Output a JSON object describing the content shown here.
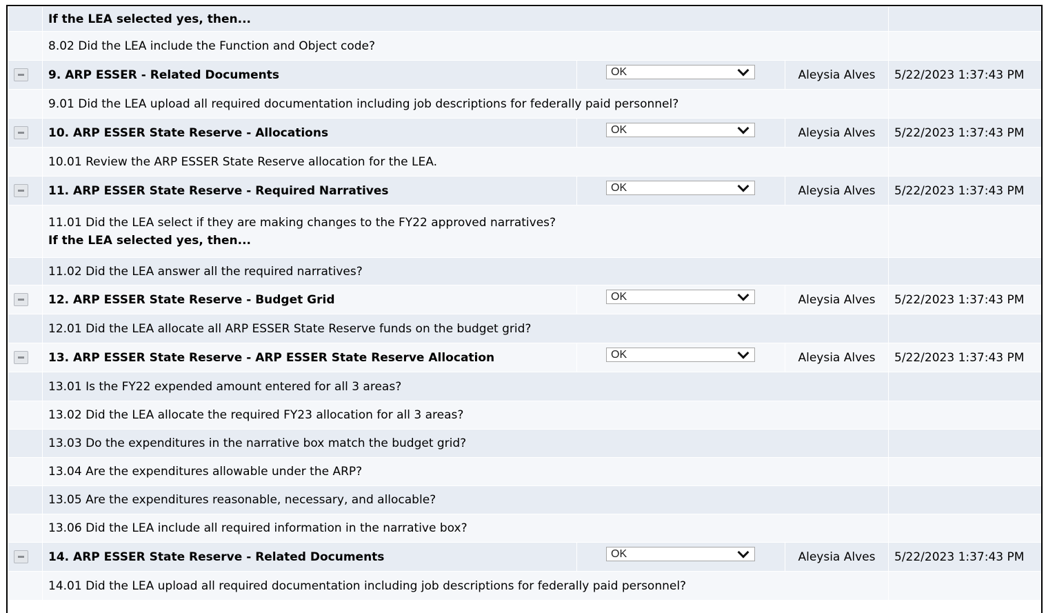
{
  "rows": [
    {
      "kind": "sub",
      "text": "If the LEA selected yes, then..."
    },
    {
      "kind": "q",
      "text": "8.02 Did the LEA include the Function and Object code?"
    },
    {
      "kind": "sec",
      "title": "9. ARP ESSER - Related Documents",
      "status": "OK",
      "reviewer": "Aleysia Alves",
      "timestamp": "5/22/2023 1:37:43 PM"
    },
    {
      "kind": "q",
      "text": "9.01 Did the LEA upload all required documentation including job descriptions for federally paid personnel?"
    },
    {
      "kind": "sec",
      "title": "10. ARP ESSER State Reserve - Allocations",
      "status": "OK",
      "reviewer": "Aleysia Alves",
      "timestamp": "5/22/2023 1:37:43 PM"
    },
    {
      "kind": "q",
      "text": "10.01 Review the ARP ESSER State Reserve allocation for the LEA."
    },
    {
      "kind": "sec",
      "title": "11. ARP ESSER State Reserve - Required Narratives",
      "status": "OK",
      "reviewer": "Aleysia Alves",
      "timestamp": "5/22/2023 1:37:43 PM"
    },
    {
      "kind": "q2",
      "text": "11.01 Did the LEA select if they are making changes to the FY22 approved narratives?",
      "sub": "If the LEA selected yes, then..."
    },
    {
      "kind": "q",
      "text": "11.02 Did the LEA answer all the required narratives?"
    },
    {
      "kind": "sec",
      "title": "12. ARP ESSER State Reserve - Budget Grid",
      "status": "OK",
      "reviewer": "Aleysia Alves",
      "timestamp": "5/22/2023 1:37:43 PM"
    },
    {
      "kind": "q",
      "text": "12.01 Did the LEA allocate all ARP ESSER State Reserve funds on the budget grid?"
    },
    {
      "kind": "sec",
      "title": "13. ARP ESSER State Reserve - ARP ESSER State Reserve Allocation",
      "status": "OK",
      "reviewer": "Aleysia Alves",
      "timestamp": "5/22/2023 1:37:43 PM"
    },
    {
      "kind": "q",
      "text": "13.01 Is the FY22 expended amount entered for all 3 areas?"
    },
    {
      "kind": "q",
      "text": "13.02 Did the LEA allocate the required FY23 allocation for all 3 areas?"
    },
    {
      "kind": "q",
      "text": "13.03 Do the expenditures in the narrative box match the budget grid?"
    },
    {
      "kind": "q",
      "text": "13.04 Are the expenditures allowable under the ARP?"
    },
    {
      "kind": "q",
      "text": "13.05 Are the expenditures reasonable, necessary, and allocable?"
    },
    {
      "kind": "q",
      "text": "13.06 Did the LEA include all required information in the narrative box?"
    },
    {
      "kind": "sec",
      "title": "14. ARP ESSER State Reserve - Related Documents",
      "status": "OK",
      "reviewer": "Aleysia Alves",
      "timestamp": "5/22/2023 1:37:43 PM"
    },
    {
      "kind": "q",
      "text": "14.01 Did the LEA upload all required documentation including job descriptions for federally paid personnel?"
    }
  ]
}
